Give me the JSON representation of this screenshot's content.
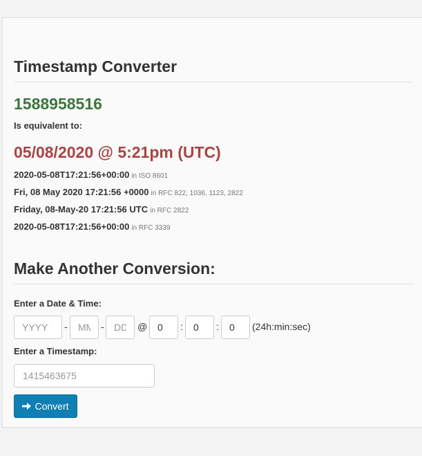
{
  "heading_main": "Timestamp Converter",
  "result": {
    "timestamp": "1588958516",
    "equivalent_label": "Is equivalent to:",
    "human_readable": "05/08/2020 @ 5:21pm (UTC)",
    "formats": [
      {
        "value": "2020-05-08T17:21:56+00:00",
        "note": "in ISO 8601"
      },
      {
        "value": "Fri, 08 May 2020 17:21:56 +0000",
        "note": "in RFC 822, 1036, 1123, 2822"
      },
      {
        "value": "Friday, 08-May-20 17:21:56 UTC",
        "note": "in RFC 2822"
      },
      {
        "value": "2020-05-08T17:21:56+00:00",
        "note": "in RFC 3339"
      }
    ]
  },
  "heading_form": "Make Another Conversion:",
  "form": {
    "datetime_label": "Enter a Date & Time:",
    "year_placeholder": "YYYY",
    "month_placeholder": "MM",
    "day_placeholder": "DD",
    "hour_value": "0",
    "minute_value": "0",
    "second_value": "0",
    "sep_dash": "-",
    "sep_at": "@",
    "sep_colon": ":",
    "time_hint": "(24h:min:sec)",
    "timestamp_label": "Enter a Timestamp:",
    "timestamp_placeholder": "1415463675",
    "convert_label": "Convert",
    "button_color": "#0f7fb4"
  }
}
